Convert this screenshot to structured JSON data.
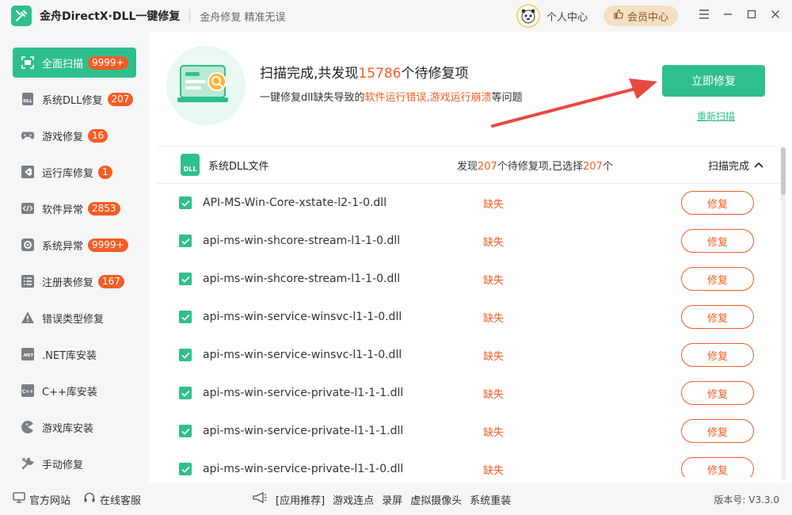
{
  "app": {
    "title": "金舟DirectX·DLL一键修复",
    "slogan": "金舟修复 精准无误",
    "user_center": "个人中心",
    "vip_label": "会员中心"
  },
  "sidebar": {
    "items": [
      {
        "label": "全面扫描",
        "badge": "9999+",
        "icon": "scan-icon"
      },
      {
        "label": "系统DLL修复",
        "badge": "207",
        "icon": "dll-icon"
      },
      {
        "label": "游戏修复",
        "badge": "16",
        "icon": "gamepad-icon"
      },
      {
        "label": "运行库修复",
        "badge": "1",
        "icon": "vs-icon"
      },
      {
        "label": "软件异常",
        "badge": "2853",
        "icon": "code-icon"
      },
      {
        "label": "系统异常",
        "badge": "9999+",
        "icon": "gear-icon"
      },
      {
        "label": "注册表修复",
        "badge": "167",
        "icon": "list-icon"
      },
      {
        "label": "错误类型修复",
        "badge": "",
        "icon": "warning-icon"
      },
      {
        "label": ".NET库安装",
        "badge": "",
        "icon": "net-icon"
      },
      {
        "label": "C++库安装",
        "badge": "",
        "icon": "cpp-icon"
      },
      {
        "label": "游戏库安装",
        "badge": "",
        "icon": "pacman-icon"
      },
      {
        "label": "手动修复",
        "badge": "",
        "icon": "wrench-icon"
      }
    ]
  },
  "banner": {
    "title_prefix": "扫描完成,共发现",
    "title_count": "15786",
    "title_suffix": "个待修复项",
    "sub_prefix": "一键修复dll缺失导致的",
    "sub_warn": "软件运行错误,游戏运行崩溃",
    "sub_suffix": "等问题",
    "fix_now": "立即修复",
    "rescan": "重新扫描"
  },
  "group": {
    "title": "系统DLL文件",
    "count_prefix": "发现",
    "count_found": "207",
    "count_mid": "个待修复项,已选择",
    "count_selected": "207",
    "count_suffix": "个",
    "status": "扫描完成",
    "icon_text": "DLL"
  },
  "rows": [
    {
      "name": "API-MS-Win-Core-xstate-l2-1-0.dll",
      "status": "缺失",
      "action": "修复"
    },
    {
      "name": "api-ms-win-shcore-stream-l1-1-0.dll",
      "status": "缺失",
      "action": "修复"
    },
    {
      "name": "api-ms-win-shcore-stream-l1-1-0.dll",
      "status": "缺失",
      "action": "修复"
    },
    {
      "name": "api-ms-win-service-winsvc-l1-1-0.dll",
      "status": "缺失",
      "action": "修复"
    },
    {
      "name": "api-ms-win-service-winsvc-l1-1-0.dll",
      "status": "缺失",
      "action": "修复"
    },
    {
      "name": "api-ms-win-service-private-l1-1-1.dll",
      "status": "缺失",
      "action": "修复"
    },
    {
      "name": "api-ms-win-service-private-l1-1-1.dll",
      "status": "缺失",
      "action": "修复"
    },
    {
      "name": "api-ms-win-service-private-l1-1-0.dll",
      "status": "缺失",
      "action": "修复"
    }
  ],
  "footer": {
    "official_site": "官方网站",
    "online_service": "在线客服",
    "recommend": "[应用推荐]",
    "rec_items": [
      "游戏连点",
      "录屏",
      "虚拟摄像头",
      "系统重装"
    ],
    "version": "版本号: V3.3.0"
  },
  "colors": {
    "accent": "#2fbf8e",
    "warn": "#f45d26",
    "vip_bg": "#f3dfc3",
    "arrow": "#e8483f"
  }
}
